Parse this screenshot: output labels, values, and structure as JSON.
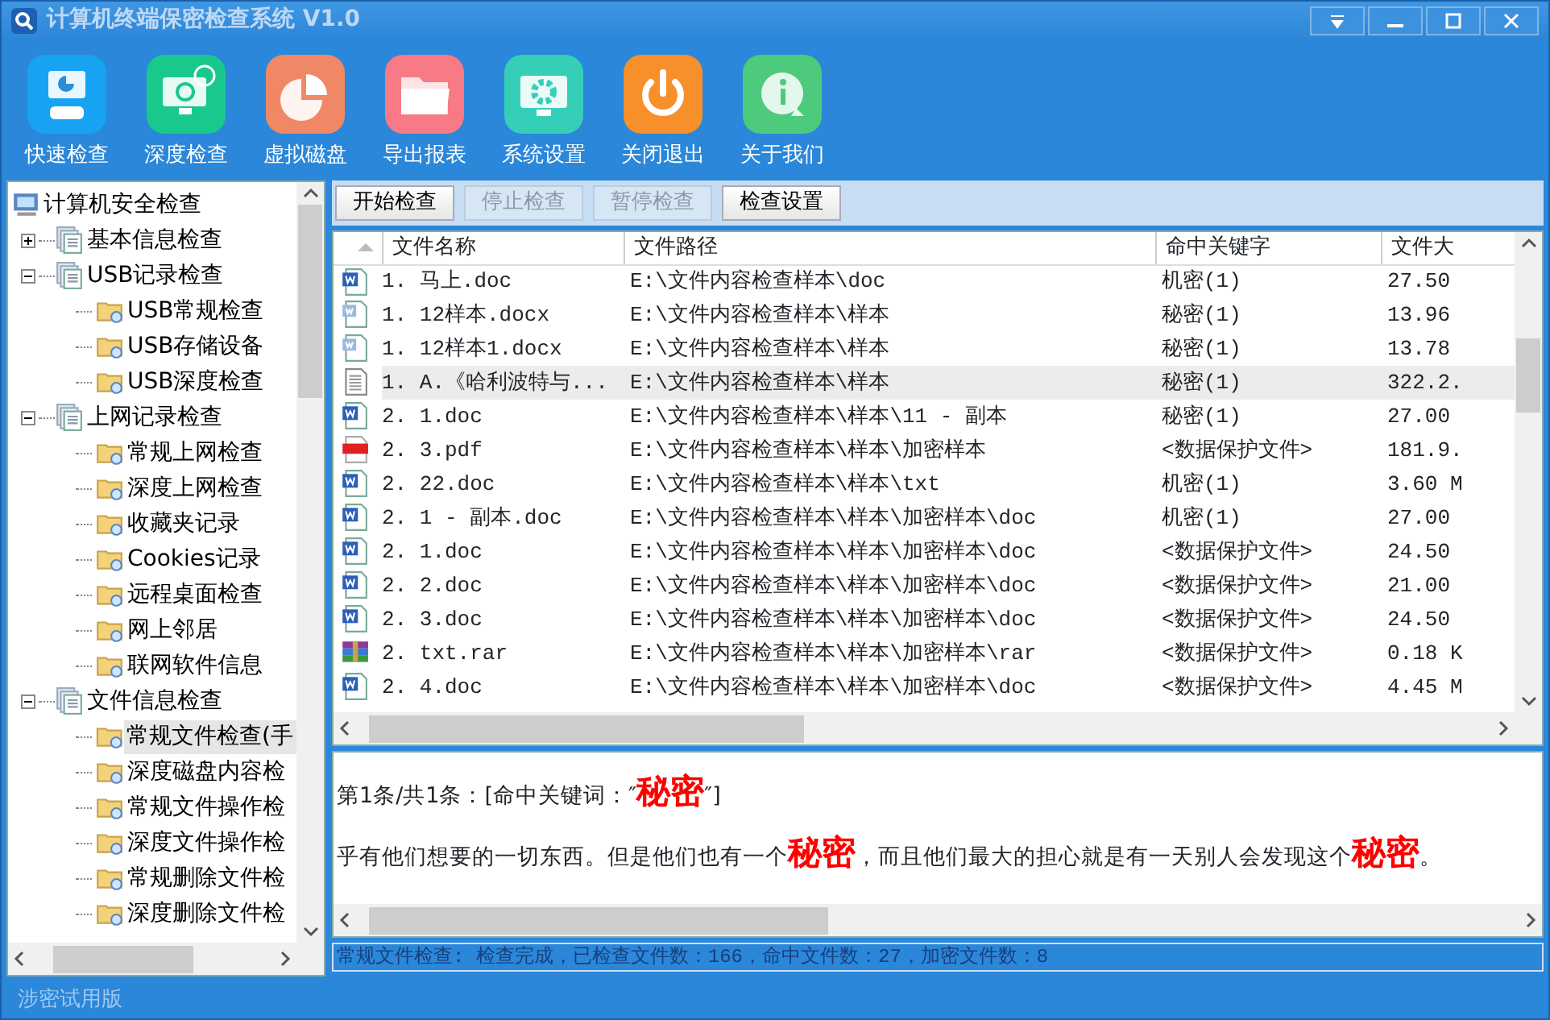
{
  "window": {
    "title": "计算机终端保密检查系统 V1.0"
  },
  "toolbar": [
    {
      "label": "快速检查",
      "kind": "quick",
      "color": "#17a3f2"
    },
    {
      "label": "深度检查",
      "kind": "deep",
      "color": "#19c98c"
    },
    {
      "label": "虚拟磁盘",
      "kind": "disk",
      "color": "#f08866"
    },
    {
      "label": "导出报表",
      "kind": "folder",
      "color": "#f77a86"
    },
    {
      "label": "系统设置",
      "kind": "settings",
      "color": "#35cfb8"
    },
    {
      "label": "关闭退出",
      "kind": "power",
      "color": "#f78f2a"
    },
    {
      "label": "关于我们",
      "kind": "info",
      "color": "#4dca7c"
    }
  ],
  "tree": [
    {
      "label": "计算机安全检查",
      "kind": "computer",
      "selected": false,
      "children": [
        {
          "label": "基本信息检查",
          "kind": "group",
          "expanded": false,
          "selected": false
        },
        {
          "label": "USB记录检查",
          "kind": "group",
          "expanded": true,
          "selected": false,
          "children": [
            {
              "label": "USB常规检查",
              "kind": "folder",
              "selected": false
            },
            {
              "label": "USB存储设备",
              "kind": "folder",
              "selected": false
            },
            {
              "label": "USB深度检查",
              "kind": "folder",
              "selected": false
            }
          ]
        },
        {
          "label": "上网记录检查",
          "kind": "group",
          "expanded": true,
          "selected": false,
          "children": [
            {
              "label": "常规上网检查",
              "kind": "folder",
              "selected": false
            },
            {
              "label": "深度上网检查",
              "kind": "folder",
              "selected": false
            },
            {
              "label": "收藏夹记录",
              "kind": "folder",
              "selected": false
            },
            {
              "label": "Cookies记录",
              "kind": "folder",
              "selected": false
            },
            {
              "label": "远程桌面检查",
              "kind": "folder",
              "selected": false
            },
            {
              "label": "网上邻居",
              "kind": "folder",
              "selected": false
            },
            {
              "label": "联网软件信息",
              "kind": "folder",
              "selected": false
            }
          ]
        },
        {
          "label": "文件信息检查",
          "kind": "group",
          "expanded": true,
          "selected": false,
          "children": [
            {
              "label": "常规文件检查(手",
              "kind": "folder",
              "selected": true
            },
            {
              "label": "深度磁盘内容检",
              "kind": "folder",
              "selected": false
            },
            {
              "label": "常规文件操作检",
              "kind": "folder",
              "selected": false
            },
            {
              "label": "深度文件操作检",
              "kind": "folder",
              "selected": false
            },
            {
              "label": "常规删除文件检",
              "kind": "folder",
              "selected": false
            },
            {
              "label": "深度删除文件检",
              "kind": "folder",
              "selected": false
            }
          ]
        }
      ]
    }
  ],
  "actions": [
    {
      "label": "开始检查",
      "disabled": false
    },
    {
      "label": "停止检查",
      "disabled": true
    },
    {
      "label": "暂停检查",
      "disabled": true
    },
    {
      "label": "检查设置",
      "disabled": false
    }
  ],
  "table": {
    "columns": [
      "文件名称",
      "文件路径",
      "命中关键字",
      "文件大"
    ],
    "rows": [
      {
        "kind": "doc",
        "selected": false,
        "cells": [
          "1. 马上.doc",
          "E:\\文件内容检查样本\\doc",
          "机密(1)",
          "27.50"
        ]
      },
      {
        "kind": "docx",
        "selected": false,
        "cells": [
          "1. 12样本.docx",
          "E:\\文件内容检查样本\\样本",
          "秘密(1)",
          "13.96"
        ]
      },
      {
        "kind": "docx",
        "selected": false,
        "cells": [
          "1. 12样本1.docx",
          "E:\\文件内容检查样本\\样本",
          "秘密(1)",
          "13.78"
        ]
      },
      {
        "kind": "txt",
        "selected": true,
        "cells": [
          "1. A.《哈利波特与...",
          "E:\\文件内容检查样本\\样本",
          "秘密(1)",
          "322.2."
        ]
      },
      {
        "kind": "doc",
        "selected": false,
        "cells": [
          "2. 1.doc",
          "E:\\文件内容检查样本\\样本\\11 - 副本",
          "秘密(1)",
          "27.00"
        ]
      },
      {
        "kind": "pdf",
        "selected": false,
        "cells": [
          "2. 3.pdf",
          "E:\\文件内容检查样本\\样本\\加密样本",
          "<数据保护文件>",
          "181.9."
        ]
      },
      {
        "kind": "doc",
        "selected": false,
        "cells": [
          "2. 22.doc",
          "E:\\文件内容检查样本\\样本\\txt",
          "机密(1)",
          "3.60 M"
        ]
      },
      {
        "kind": "doc",
        "selected": false,
        "cells": [
          "2. 1 - 副本.doc",
          "E:\\文件内容检查样本\\样本\\加密样本\\doc",
          "机密(1)",
          "27.00"
        ]
      },
      {
        "kind": "doc",
        "selected": false,
        "cells": [
          "2. 1.doc",
          "E:\\文件内容检查样本\\样本\\加密样本\\doc",
          "<数据保护文件>",
          "24.50"
        ]
      },
      {
        "kind": "doc",
        "selected": false,
        "cells": [
          "2. 2.doc",
          "E:\\文件内容检查样本\\样本\\加密样本\\doc",
          "<数据保护文件>",
          "21.00"
        ]
      },
      {
        "kind": "doc",
        "selected": false,
        "cells": [
          "2. 3.doc",
          "E:\\文件内容检查样本\\样本\\加密样本\\doc",
          "<数据保护文件>",
          "24.50"
        ]
      },
      {
        "kind": "rar",
        "selected": false,
        "cells": [
          "2. txt.rar",
          "E:\\文件内容检查样本\\样本\\加密样本\\rar",
          "<数据保护文件>",
          "0.18 K"
        ]
      },
      {
        "kind": "doc",
        "selected": false,
        "cells": [
          "2. 4.doc",
          "E:\\文件内容检查样本\\样本\\加密样本\\doc",
          "<数据保护文件>",
          "4.45 M"
        ]
      }
    ]
  },
  "preview": [
    [
      {
        "kind": "plain",
        "text": "第1条/共1条：[命中关键词：″"
      },
      {
        "kind": "hit",
        "text": "秘密"
      },
      {
        "kind": "plain",
        "text": "″]"
      }
    ],
    [
      {
        "kind": "plain",
        "text": "乎有他们想要的一切东西。但是他们也有一个"
      },
      {
        "kind": "hit",
        "text": "秘密"
      },
      {
        "kind": "plain",
        "text": "，而且他们最大的担心就是有一天别人会发现这个"
      },
      {
        "kind": "hit",
        "text": "秘密"
      },
      {
        "kind": "plain",
        "text": "。"
      }
    ]
  ],
  "status_bar": "常规文件检查: 检查完成，已检查文件数：166，命中文件数：27，加密文件数：8",
  "footer": "涉密试用版"
}
